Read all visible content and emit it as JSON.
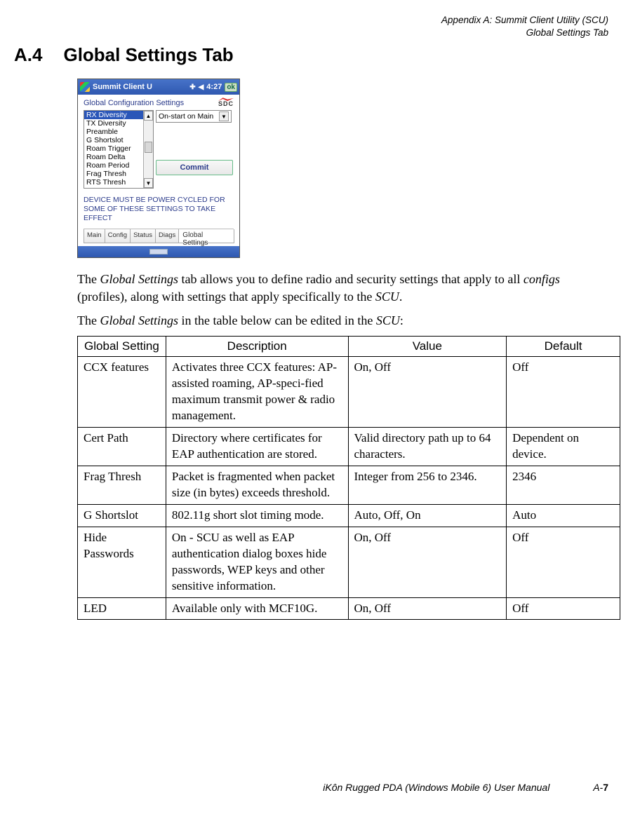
{
  "header": {
    "line1": "Appendix A:  Summit Client Utility (SCU)",
    "line2": "Global Settings Tab"
  },
  "section": {
    "number": "A.4",
    "title": "Global Settings Tab"
  },
  "pda": {
    "titlebar_text": "Summit Client U",
    "time": "4:27",
    "ok": "ok",
    "caption": "Global Configuration Settings",
    "logo": "SDC",
    "list_items": [
      "RX Diversity",
      "TX Diversity",
      "Preamble",
      "G Shortslot",
      "Roam Trigger",
      "Roam Delta",
      "Roam Period",
      "Frag Thresh",
      "RTS Thresh"
    ],
    "dropdown_value": "On-start on Main",
    "commit_label": "Commit",
    "message": "DEVICE MUST BE POWER CYCLED FOR SOME OF THESE SETTINGS TO TAKE EFFECT",
    "tabs": [
      "Main",
      "Config",
      "Status",
      "Diags",
      "Global Settings"
    ]
  },
  "paragraphs": {
    "p1_a": "The ",
    "p1_b": "Global Settings",
    "p1_c": " tab allows you to define radio and security settings that apply to all ",
    "p1_d": "configs",
    "p1_e": " (profiles), along with settings that apply specifically to the ",
    "p1_f": "SCU",
    "p1_g": ".",
    "p2_a": "The ",
    "p2_b": "Global Settings",
    "p2_c": " in the table below can be edited in the ",
    "p2_d": "SCU",
    "p2_e": ":"
  },
  "table": {
    "headers": {
      "c1": "Global Setting",
      "c2": "Description",
      "c3": "Value",
      "c4": "Default"
    },
    "rows": [
      {
        "c1": "CCX features",
        "c2": "Activates three CCX features: AP-assisted roaming, AP-speci-fied maximum transmit power & radio management.",
        "c3": "On, Off",
        "c4": "Off"
      },
      {
        "c1": "Cert Path",
        "c2": "Directory where certificates for EAP authentication are stored.",
        "c3": "Valid directory path up to 64 characters.",
        "c4": "Dependent on device."
      },
      {
        "c1": "Frag Thresh",
        "c2": "Packet is fragmented when packet size (in bytes) exceeds threshold.",
        "c3": "Integer from 256 to 2346.",
        "c4": "2346"
      },
      {
        "c1": "G Shortslot",
        "c2": "802.11g short slot timing mode.",
        "c3": "Auto, Off, On",
        "c4": "Auto"
      },
      {
        "c1": "Hide Passwords",
        "c2": "On - SCU as well as EAP authentication dialog boxes hide passwords, WEP keys and other sensitive information.",
        "c3": "On, Off",
        "c4": "Off"
      },
      {
        "c1": "LED",
        "c2": "Available only with MCF10G.",
        "c3": "On, Off",
        "c4": "Off"
      }
    ]
  },
  "footer": {
    "text": "iKôn Rugged PDA (Windows Mobile 6) User Manual",
    "page_prefix": "A-",
    "page_num": "7"
  }
}
